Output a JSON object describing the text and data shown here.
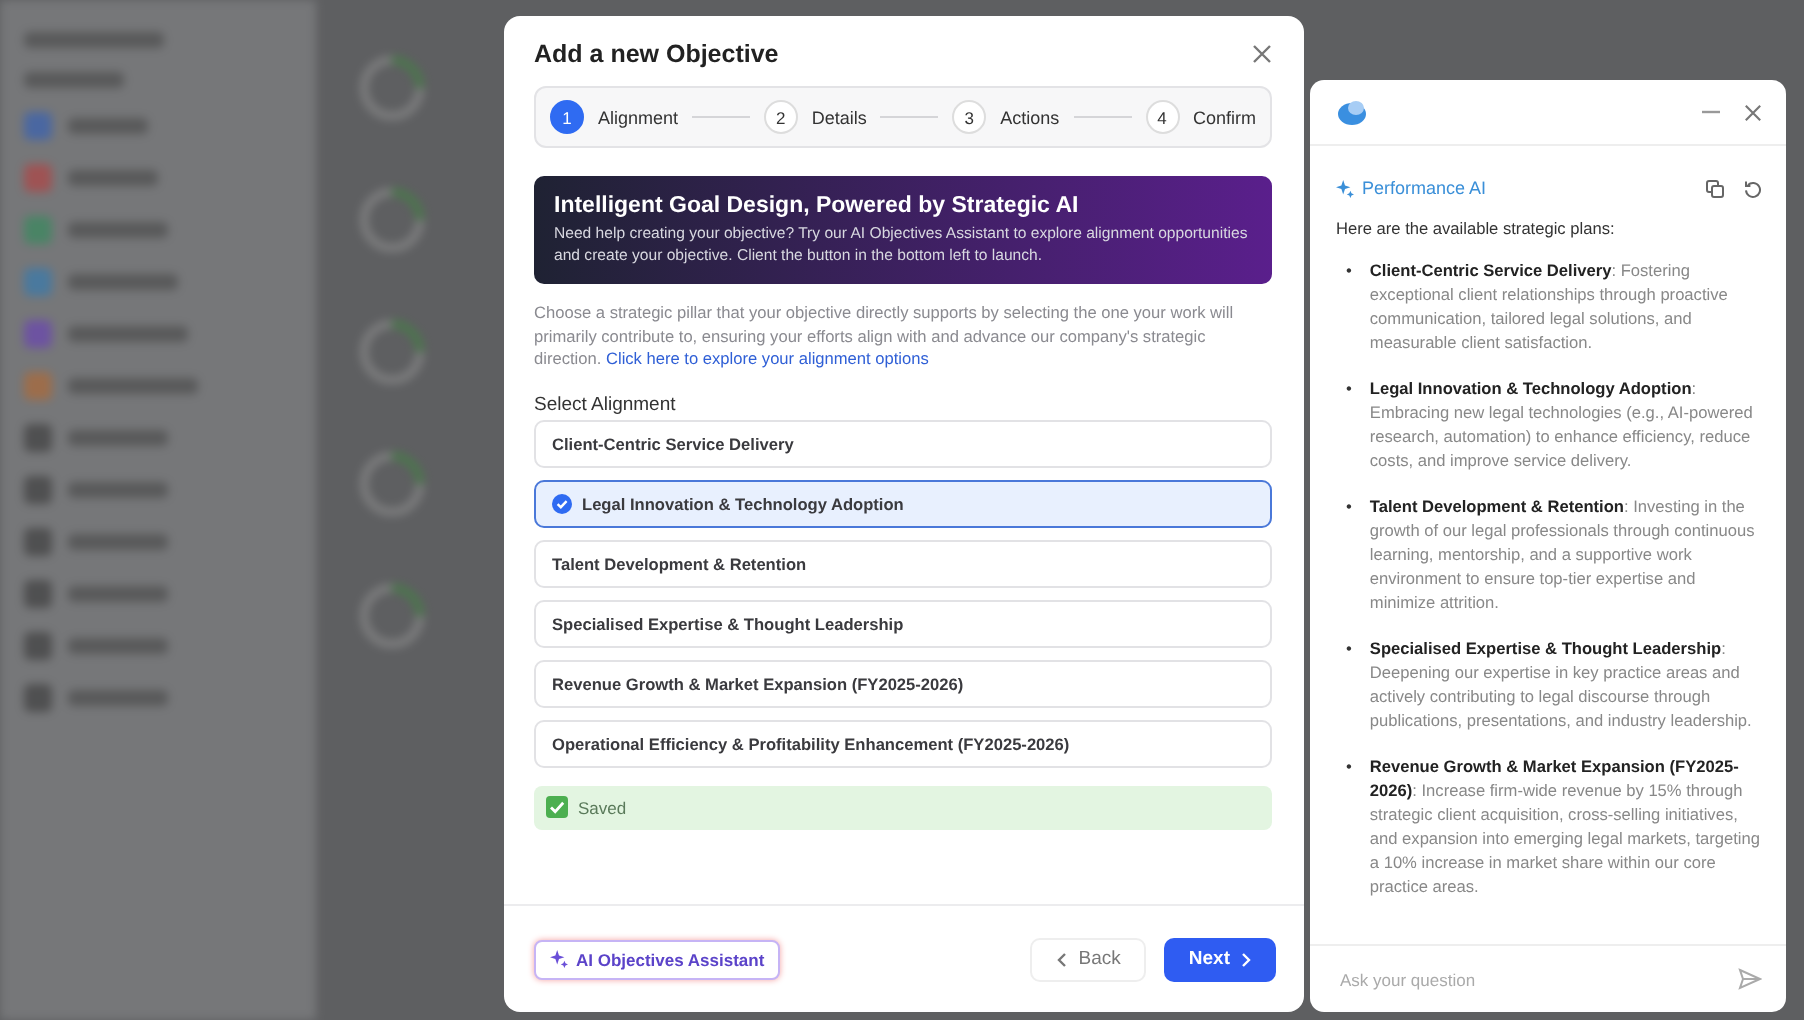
{
  "modal": {
    "title": "Add a new Objective",
    "steps": [
      {
        "number": "1",
        "label": "Alignment",
        "selected": true
      },
      {
        "number": "2",
        "label": "Details",
        "selected": false
      },
      {
        "number": "3",
        "label": "Actions",
        "selected": false
      },
      {
        "number": "4",
        "label": "Confirm",
        "selected": false
      }
    ],
    "banner": {
      "title": "Intelligent Goal Design, Powered by Strategic AI",
      "text": "Need help creating your objective? Try our AI Objectives Assistant to explore alignment opportunities and create your objective. Client the button in the bottom left to launch."
    },
    "description": "Choose a strategic pillar that your objective directly supports by selecting the one your work will primarily contribute to, ensuring your efforts align with and advance our company's strategic direction.",
    "link": "Click here to explore your alignment options",
    "section_label": "Select Alignment",
    "options": [
      {
        "label": "Client-Centric Service Delivery",
        "selected": false
      },
      {
        "label": "Legal Innovation & Technology Adoption",
        "selected": true
      },
      {
        "label": "Talent Development & Retention",
        "selected": false
      },
      {
        "label": "Specialised Expertise & Thought Leadership",
        "selected": false
      },
      {
        "label": "Revenue Growth & Market Expansion (FY2025-2026)",
        "selected": false
      },
      {
        "label": "Operational Efficiency & Profitability Enhancement (FY2025-2026)",
        "selected": false
      }
    ],
    "status": {
      "kind": "saved",
      "text": "Saved"
    },
    "assistant_button": "AI Objectives Assistant",
    "back_button": "Back",
    "next_button": "Next"
  },
  "assistant": {
    "name": "Performance AI",
    "intro": "Here are the available strategic plans:",
    "plans": [
      {
        "bullet": "•",
        "text": "**Client-Centric Service Delivery**: Fostering exceptional client relationships through proactive communication, tailored legal solutions, and measurable client satisfaction."
      },
      {
        "bullet": "•",
        "text": "**Legal Innovation & Technology Adoption**: Embracing new legal technologies (e.g., AI-powered research, automation) to enhance efficiency, reduce costs, and improve service delivery."
      },
      {
        "bullet": "•",
        "text": "**Talent Development & Retention**: Investing in the growth of our legal professionals through continuous learning, mentorship, and a supportive work environment to ensure top-tier expertise and minimize attrition."
      },
      {
        "bullet": "•",
        "text": "**Specialised Expertise & Thought Leadership**: Deepening our expertise in key practice areas and actively contributing to legal discourse through publications, presentations, and industry leadership."
      },
      {
        "bullet": "•",
        "text": "**Revenue Growth & Market Expansion (FY2025-2026)**: Increase firm-wide revenue by 15% through strategic client acquisition, cross-selling initiatives, and expansion into emerging legal markets, targeting a 10% increase in market share within our core practice areas."
      }
    ],
    "input_placeholder": "Ask your question"
  }
}
